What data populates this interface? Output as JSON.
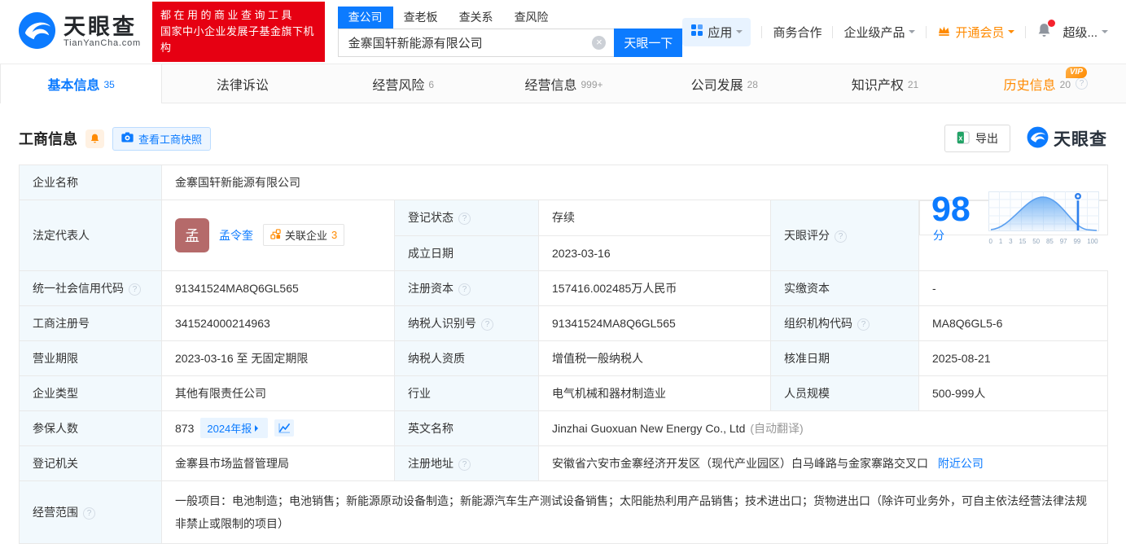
{
  "header": {
    "logo": {
      "title": "天眼查",
      "subtitle": "TianYanCha.com"
    },
    "slogan": {
      "line1": "都在用的商业查询工具",
      "line2": "国家中小企业发展子基金旗下机构"
    },
    "search": {
      "tabs": [
        {
          "label": "查公司"
        },
        {
          "label": "查老板"
        },
        {
          "label": "查关系"
        },
        {
          "label": "查风险"
        }
      ],
      "value": "金寨国轩新能源有限公司",
      "button": "天眼一下"
    },
    "nav": {
      "apps": "应用",
      "cooperation": "商务合作",
      "enterprise": "企业级产品",
      "vip": "开通会员",
      "more": "超级..."
    }
  },
  "tabs": [
    {
      "label": "基本信息",
      "count": "35"
    },
    {
      "label": "法律诉讼",
      "count": ""
    },
    {
      "label": "经营风险",
      "count": "6"
    },
    {
      "label": "经营信息",
      "count": "999+"
    },
    {
      "label": "公司发展",
      "count": "28"
    },
    {
      "label": "知识产权",
      "count": "21"
    },
    {
      "label": "历史信息",
      "count": "20",
      "vip": "VIP"
    }
  ],
  "section": {
    "title": "工商信息",
    "snapshot_button": "查看工商快照",
    "export_button": "导出",
    "watermark": "天眼查"
  },
  "table": {
    "company_name": {
      "label": "企业名称",
      "value": "金寨国轩新能源有限公司"
    },
    "legal_rep": {
      "label": "法定代表人",
      "avatar": "孟",
      "name": "孟令奎",
      "related": "关联企业",
      "related_count": "3"
    },
    "reg_status": {
      "label": "登记状态",
      "value": "存续"
    },
    "establish_date": {
      "label": "成立日期",
      "value": "2023-03-16"
    },
    "score": {
      "label": "天眼评分",
      "value": "98",
      "unit": "分",
      "ticks": [
        "0",
        "1",
        "3",
        "15",
        "50",
        "85",
        "97",
        "99",
        "100"
      ]
    },
    "credit_code": {
      "label": "统一社会信用代码",
      "value": "91341524MA8Q6GL565"
    },
    "reg_capital": {
      "label": "注册资本",
      "value": "157416.002485万人民币"
    },
    "paid_capital": {
      "label": "实缴资本",
      "value": "-"
    },
    "reg_number": {
      "label": "工商注册号",
      "value": "341524000214963"
    },
    "taxpayer_id": {
      "label": "纳税人识别号",
      "value": "91341524MA8Q6GL565"
    },
    "org_code": {
      "label": "组织机构代码",
      "value": "MA8Q6GL5-6"
    },
    "business_term": {
      "label": "营业期限",
      "value": "2023-03-16 至 无固定期限"
    },
    "taxpayer_quality": {
      "label": "纳税人资质",
      "value": "增值税一般纳税人"
    },
    "approval_date": {
      "label": "核准日期",
      "value": "2025-08-21"
    },
    "company_type": {
      "label": "企业类型",
      "value": "其他有限责任公司"
    },
    "industry": {
      "label": "行业",
      "value": "电气机械和器材制造业"
    },
    "staff_size": {
      "label": "人员规模",
      "value": "500-999人"
    },
    "insured_count": {
      "label": "参保人数",
      "value": "873",
      "report_tag": "2024年报"
    },
    "english_name": {
      "label": "英文名称",
      "value": "Jinzhai Guoxuan New Energy Co., Ltd",
      "note": "(自动翻译)"
    },
    "reg_authority": {
      "label": "登记机关",
      "value": "金寨县市场监督管理局"
    },
    "reg_address": {
      "label": "注册地址",
      "value": "安徽省六安市金寨经济开发区（现代产业园区）白马峰路与金家寨路交叉口",
      "nearby_link": "附近公司"
    },
    "business_scope": {
      "label": "经营范围",
      "value": "一般项目：电池制造；电池销售；新能源原动设备制造；新能源汽车生产测试设备销售；太阳能热利用产品销售；技术进出口；货物进出口（除许可业务外，可自主依法经营法律法规非禁止或限制的项目）"
    }
  }
}
